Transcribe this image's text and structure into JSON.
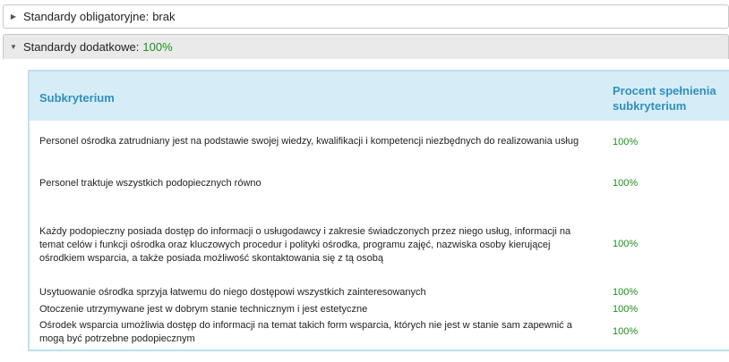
{
  "sections": [
    {
      "title": "Standardy obligatoryjne:",
      "value": "brak",
      "expanded": false,
      "value_color": "#222222"
    },
    {
      "title": "Standardy dodatkowe:",
      "value": "100%",
      "expanded": true,
      "value_color": "#1f8f1f"
    }
  ],
  "table": {
    "headers": {
      "criterion": "Subkryterium",
      "percent_line1": "Procent spełnienia",
      "percent_line2": "subkryterium"
    },
    "rows": [
      {
        "lines": [
          "Personel ośrodka zatrudniany jest na podstawie swojej wiedzy, kwalifikacji i kompetencji niezbędnych do realizowania usług"
        ],
        "value": "100%"
      },
      {
        "lines": [
          "Personel traktuje wszystkich podopiecznych równo"
        ],
        "value": "100%"
      },
      {
        "lines": [
          "Każdy podopieczny posiada dostęp do informacji o usługodawcy i zakresie świadczonych przez niego usług, informacji na",
          "temat celów i funkcji ośrodka oraz kluczowych procedur i polityki ośrodka, programu zajęć, nazwiska osoby kierującej",
          "ośrodkiem wsparcia, a także posiada możliwość skontaktowania się z tą osobą"
        ],
        "value": "100%"
      },
      {
        "lines": [
          "Usytuowanie ośrodka sprzyja łatwemu do niego dostępowi wszystkich zainteresowanych"
        ],
        "value": "100%"
      },
      {
        "lines": [
          "Otoczenie utrzymywane jest w dobrym stanie technicznym i jest estetyczne"
        ],
        "value": "100%"
      },
      {
        "lines": [
          "Ośrodek wsparcia umożliwia dostęp do informacji na temat takich form wsparcia, których nie jest w stanie sam zapewnić a",
          "mogą być potrzebne podopiecznym"
        ],
        "value": "100%"
      }
    ]
  },
  "colors": {
    "header_bg": "#d6edf7",
    "header_text": "#2f8fbd",
    "value_green": "#1f8f1f"
  }
}
